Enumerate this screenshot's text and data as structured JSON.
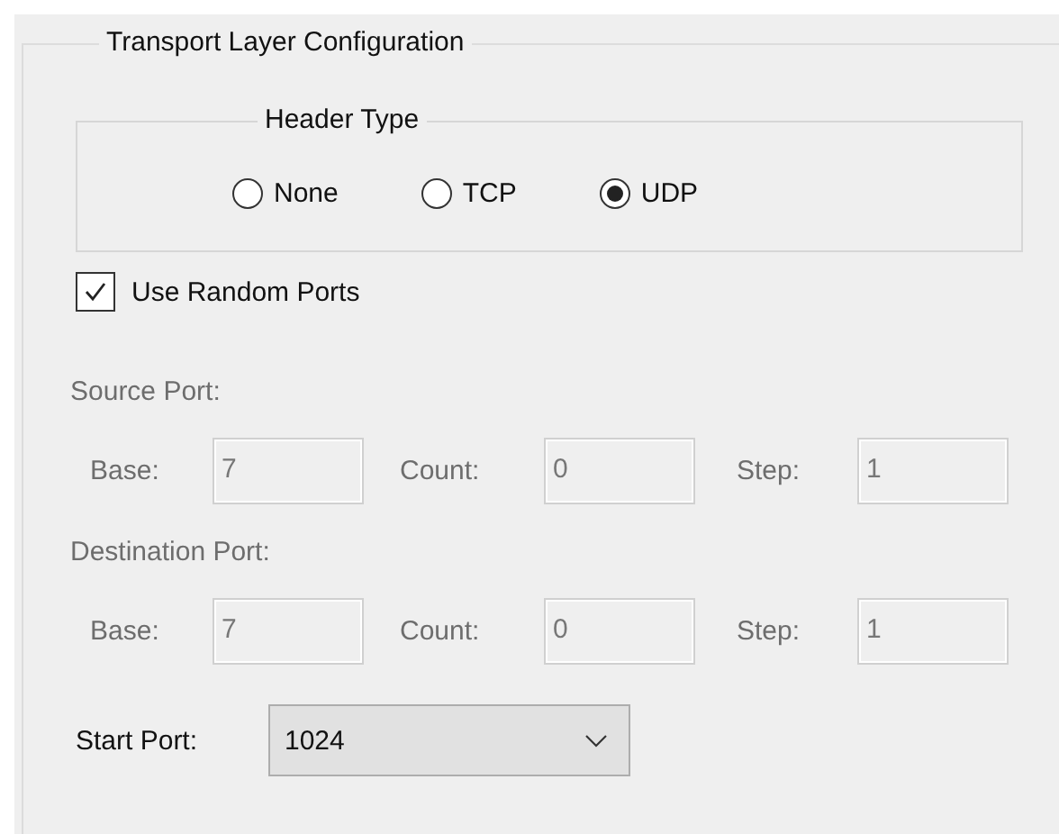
{
  "group": {
    "title": "Transport Layer Configuration"
  },
  "header_type": {
    "title": "Header Type",
    "options": [
      {
        "label": "None",
        "selected": false
      },
      {
        "label": "TCP",
        "selected": false
      },
      {
        "label": "UDP",
        "selected": true
      }
    ]
  },
  "use_random_ports": {
    "label": "Use Random Ports",
    "checked": true
  },
  "port_sections": [
    {
      "title": "Source Port:",
      "disabled": true,
      "fields": [
        {
          "label": "Base:",
          "value": "7"
        },
        {
          "label": "Count:",
          "value": "0"
        },
        {
          "label": "Step:",
          "value": "1"
        }
      ]
    },
    {
      "title": "Destination Port:",
      "disabled": true,
      "fields": [
        {
          "label": "Base:",
          "value": "7"
        },
        {
          "label": "Count:",
          "value": "0"
        },
        {
          "label": "Step:",
          "value": "1"
        }
      ]
    }
  ],
  "start_port": {
    "label": "Start Port:",
    "value": "1024"
  }
}
